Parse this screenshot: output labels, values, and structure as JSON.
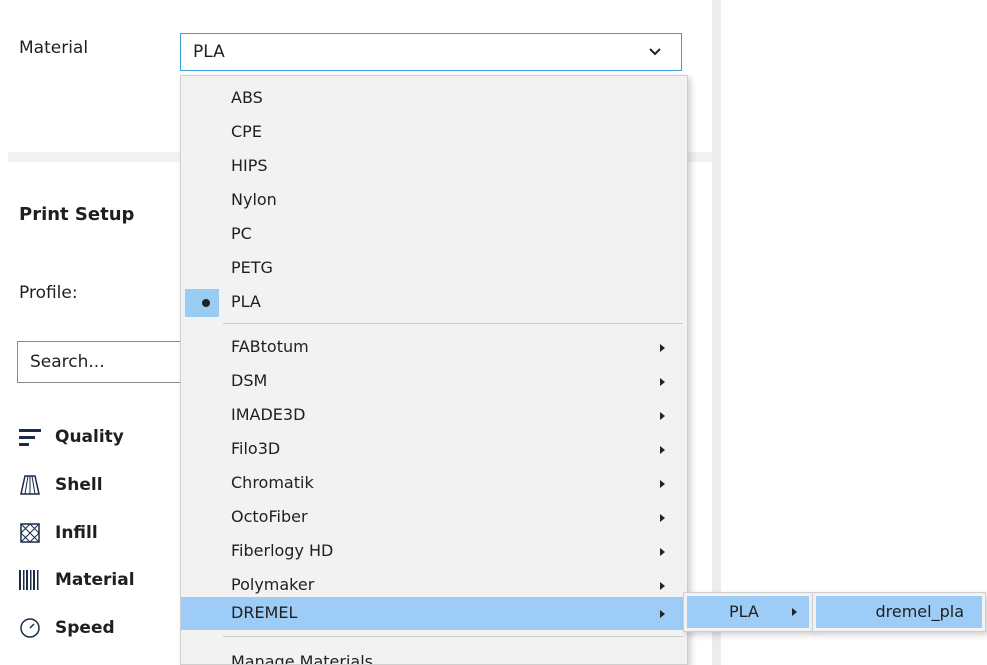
{
  "material": {
    "label": "Material",
    "selected": "PLA"
  },
  "print_setup": {
    "title": "Print Setup",
    "profile_label": "Profile:"
  },
  "search": {
    "placeholder": "Search..."
  },
  "categories": [
    {
      "label": "Quality",
      "icon": "quality-icon"
    },
    {
      "label": "Shell",
      "icon": "shell-icon"
    },
    {
      "label": "Infill",
      "icon": "infill-icon"
    },
    {
      "label": "Material",
      "icon": "material-icon"
    },
    {
      "label": "Speed",
      "icon": "speed-icon"
    }
  ],
  "dropdown": {
    "generic": [
      "ABS",
      "CPE",
      "HIPS",
      "Nylon",
      "PC",
      "PETG",
      "PLA"
    ],
    "checked": "PLA",
    "brands": [
      "FABtotum",
      "DSM",
      "IMADE3D",
      "Filo3D",
      "Chromatik",
      "OctoFiber",
      "Fiberlogy HD",
      "Polymaker",
      "DREMEL"
    ],
    "highlighted_brand": "DREMEL",
    "manage": "Manage Materials..."
  },
  "submenu": {
    "type": "PLA",
    "profile": "dremel_pla"
  },
  "colors": {
    "accent_border": "#3aa0d6",
    "highlight": "#9dcdf7",
    "menu_bg": "#f2f2f2"
  }
}
